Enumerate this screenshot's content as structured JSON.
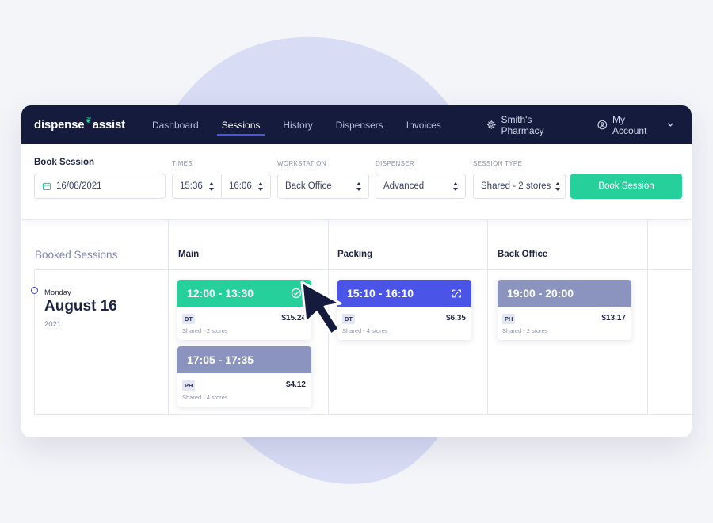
{
  "nav": {
    "logo_left": "dispense",
    "logo_right": "assist",
    "items": [
      {
        "label": "Dashboard"
      },
      {
        "label": "Sessions"
      },
      {
        "label": "History"
      },
      {
        "label": "Dispensers"
      },
      {
        "label": "Invoices"
      }
    ],
    "active_item": "Sessions",
    "pharmacy": "Smith's Pharmacy",
    "account": "My Account",
    "icons": {
      "pharmacy": "gear-icon",
      "account": "user-icon",
      "dropdown": "chevron-down-icon"
    }
  },
  "book_session": {
    "title": "Book Session",
    "date": "16/08/2021",
    "times_label": "TIMES",
    "time_start": "15:36",
    "time_end": "16:06",
    "workstation_label": "WORKSTATION",
    "workstation": "Back Office",
    "dispenser_label": "DISPENSER",
    "dispenser": "Advanced",
    "session_type_label": "SESSION TYPE",
    "session_type": "Shared - 2 stores",
    "button_label": "Book Session"
  },
  "booked": {
    "title": "Booked Sessions",
    "columns": [
      "Main",
      "Packing",
      "Back Office"
    ],
    "day": {
      "weekday": "Monday",
      "date": "August 16",
      "year": "2021"
    },
    "sessions": [
      {
        "time": "12:00 - 13:30",
        "tag": "DT",
        "price": "$15.24",
        "type": "Shared - 2 stores",
        "color": "#26d09b",
        "icon": "check-circle-icon"
      },
      {
        "time": "17:05 - 17:35",
        "tag": "PH",
        "price": "$4.12",
        "type": "Shared - 4 stores",
        "color": "#8b94bf"
      },
      {
        "time": "15:10 - 16:10",
        "tag": "DT",
        "price": "$6.35",
        "type": "Shared - 4 stores",
        "color": "#4a55e8",
        "icon": "swap-icon"
      },
      {
        "time": "19:00 - 20:00",
        "tag": "PH",
        "price": "$13.17",
        "type": "Shared - 2 stores",
        "color": "#8b94bf"
      }
    ]
  },
  "colors": {
    "nav_bg": "#141b3d",
    "accent_green": "#26d09b",
    "accent_blue": "#4a55e8",
    "muted": "#8b94bf"
  }
}
